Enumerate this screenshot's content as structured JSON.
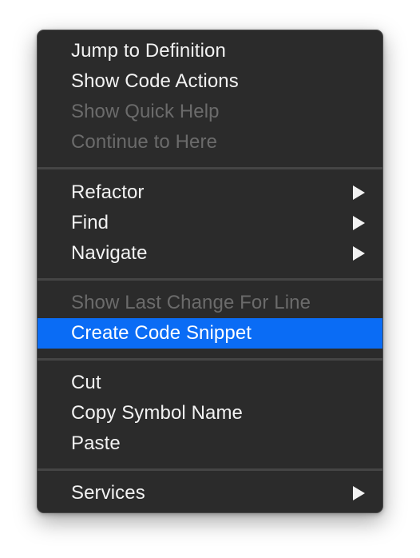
{
  "menu": {
    "items": [
      {
        "label": "Jump to Definition"
      },
      {
        "label": "Show Code Actions"
      },
      {
        "label": "Show Quick Help"
      },
      {
        "label": "Continue to Here"
      },
      {
        "label": "Refactor"
      },
      {
        "label": "Find"
      },
      {
        "label": "Navigate"
      },
      {
        "label": "Show Last Change For Line"
      },
      {
        "label": "Create Code Snippet"
      },
      {
        "label": "Cut"
      },
      {
        "label": "Copy Symbol Name"
      },
      {
        "label": "Paste"
      },
      {
        "label": "Services"
      }
    ],
    "highlight_color": "#0a6cf5",
    "disabled_color": "#6b6b6b",
    "background_color": "#2b2b2b",
    "submenu_icon": "triangle-right-icon"
  }
}
